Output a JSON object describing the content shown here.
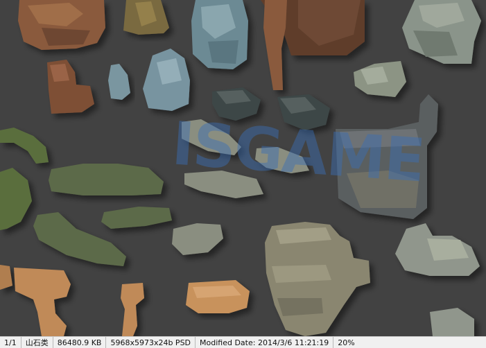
{
  "canvas": {
    "background": "#424242",
    "assets": [
      {
        "name": "rock-brown-cliff-topleft",
        "color": "#8a5a3c"
      },
      {
        "name": "rock-brown-pillar-topleft",
        "color": "#7a6a3f"
      },
      {
        "name": "rock-blue-crystal-large",
        "color": "#6c8a94"
      },
      {
        "name": "rock-brown-tall-pillar",
        "color": "#7a5038"
      },
      {
        "name": "rock-grey-stone-cluster-topright",
        "color": "#8a948a"
      },
      {
        "name": "rock-brown-stack",
        "color": "#7e5036"
      },
      {
        "name": "rock-blue-shard-small",
        "color": "#7a96a0"
      },
      {
        "name": "rock-blue-crystal-medium",
        "color": "#7894a0"
      },
      {
        "name": "rock-grey-cluster-small",
        "color": "#8c9484"
      },
      {
        "name": "rock-dark-flat-stones",
        "color": "#3c4646"
      },
      {
        "name": "rock-grey-wall-corner",
        "color": "#5a5e60"
      },
      {
        "name": "stone-wall-mossy-curve",
        "color": "#5a6e3e"
      },
      {
        "name": "stone-wall-mossy-straight",
        "color": "#5c6a48"
      },
      {
        "name": "stone-pile-grey",
        "color": "#8a8e80"
      },
      {
        "name": "rock-layered-grey-large",
        "color": "#8a8670"
      },
      {
        "name": "rock-mossy-boulders",
        "color": "#90968c"
      },
      {
        "name": "rock-sandstone-pillar",
        "color": "#c08a58"
      },
      {
        "name": "rock-sandstone-slab",
        "color": "#c8925c"
      }
    ],
    "watermark_text": "ISGAME"
  },
  "statusbar": {
    "page": "1/1",
    "doc_name": "山石类",
    "file_size": "86480.9 KB",
    "dimensions": "5968x5973x24b PSD",
    "modified": "Modified Date: 2014/3/6 11:21:19",
    "zoom": "20%"
  }
}
